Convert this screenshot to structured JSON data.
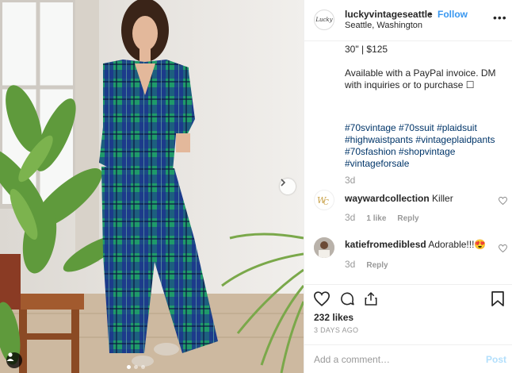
{
  "header": {
    "logo_text": "Lucky",
    "username": "luckyvintageseattle",
    "separator": "•",
    "follow_label": "Follow",
    "location": "Seattle, Washington",
    "more_label": "•••"
  },
  "caption": {
    "line1": "30\" | $125",
    "line2": "Available with a PayPal invoice. DM",
    "line3": "with inquiries or to purchase ☐",
    "hashtags": [
      "#70svintage #70ssuit #plaidsuit",
      "#highwaistpants #vintageplaidpants",
      "#70sfashion #shopvintage",
      "#vintageforsale"
    ],
    "time": "3d"
  },
  "comments": [
    {
      "user": "waywardcollection",
      "text": "Killer",
      "time": "3d",
      "likes": "1 like",
      "reply": "Reply",
      "avatar_icon": "ww-monogram-icon"
    },
    {
      "user": "katiefromediblesd",
      "text": "Adorable!!!😍",
      "time": "3d",
      "reply": "Reply",
      "avatar_icon": "user-photo"
    }
  ],
  "actions": {
    "likes": "232 likes",
    "date": "3 DAYS AGO",
    "icons": [
      "heart-icon",
      "comment-icon",
      "share-icon",
      "bookmark-icon"
    ]
  },
  "add_comment": {
    "placeholder": "Add a comment…",
    "post_label": "Post"
  },
  "colors": {
    "accent": "#3897f0",
    "hashtag": "#003569",
    "muted": "#999999",
    "post_disabled": "#b2dffc",
    "plaid_green": "#1f9a6a",
    "plaid_blue": "#1b2f8f"
  }
}
